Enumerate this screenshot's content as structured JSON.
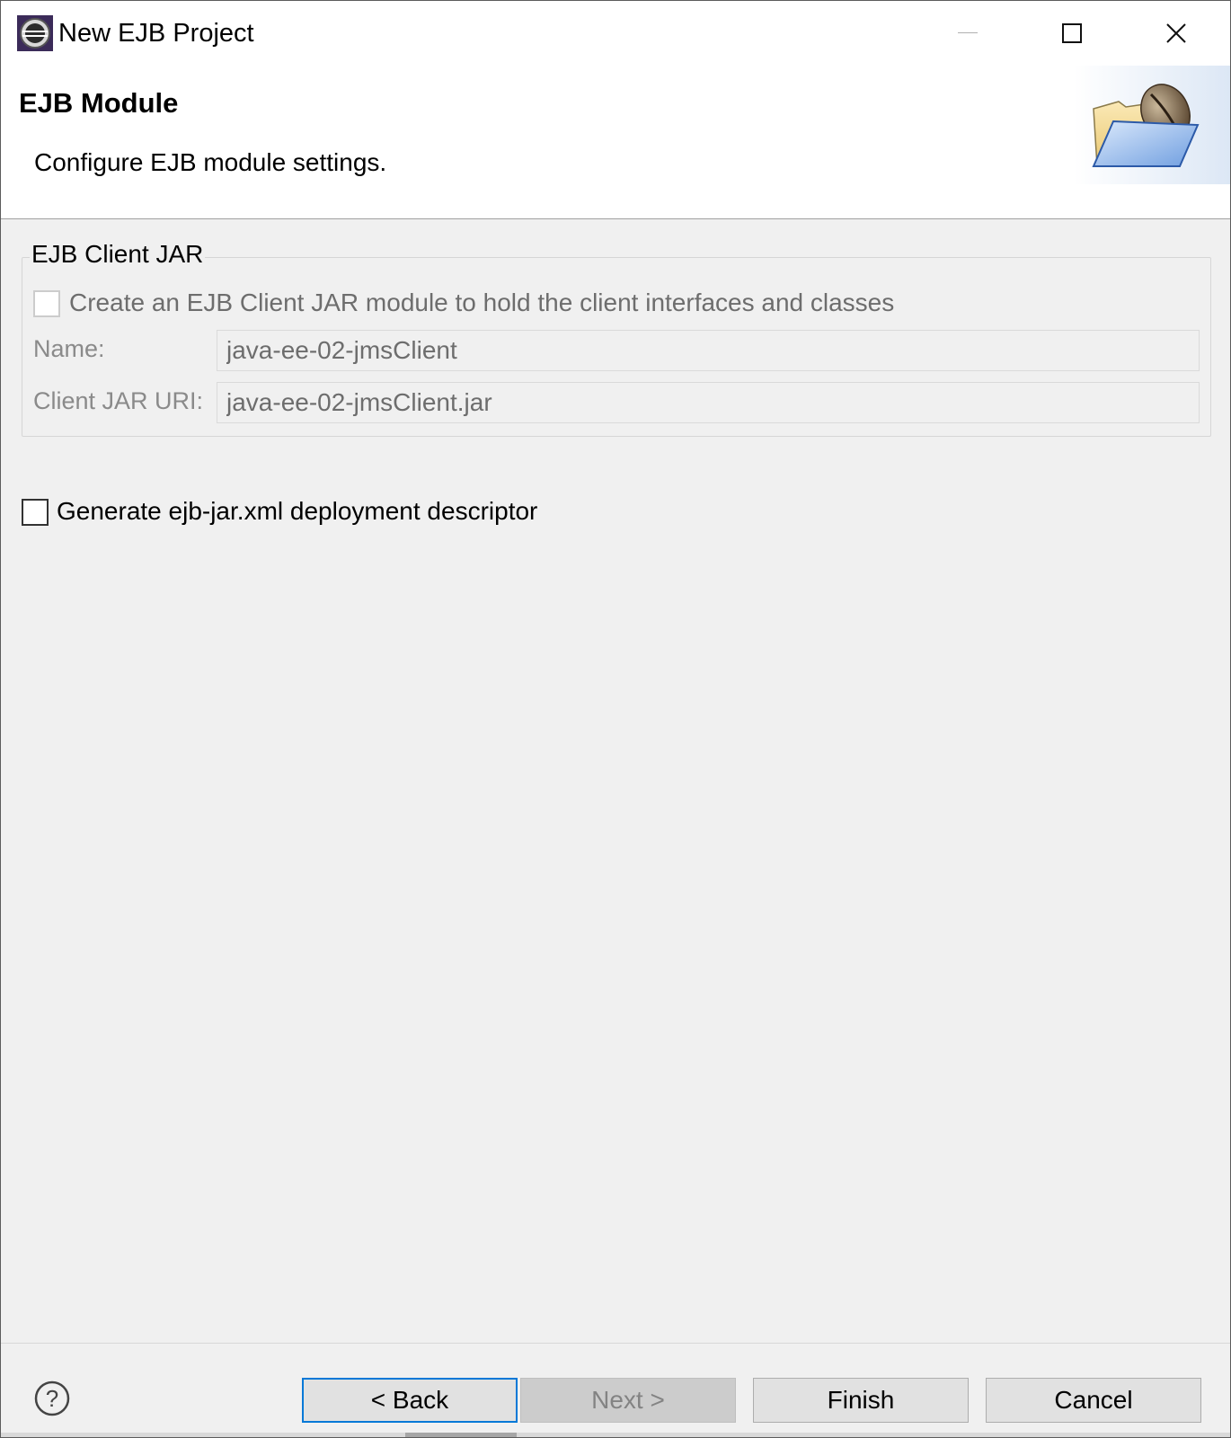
{
  "window": {
    "title": "New EJB Project",
    "app_icon": "eclipse-icon",
    "controls": [
      "minimize-icon",
      "maximize-icon",
      "close-icon"
    ]
  },
  "banner": {
    "title": "EJB Module",
    "description": "Configure EJB module settings.",
    "image": "ejb-folder-wizard-icon"
  },
  "client_jar_group": {
    "legend": "EJB Client JAR",
    "create_checkbox": {
      "label": "Create an EJB Client JAR module to hold the client interfaces and classes",
      "checked": false,
      "enabled": false
    },
    "name_label": "Name:",
    "name_value": "java-ee-02-jmsClient",
    "uri_label": "Client JAR URI:",
    "uri_value": "java-ee-02-jmsClient.jar"
  },
  "generate_descriptor": {
    "label": "Generate ejb-jar.xml deployment descriptor",
    "checked": false
  },
  "footer": {
    "help_icon": "help-icon",
    "back": "< Back",
    "next": "Next >",
    "finish": "Finish",
    "cancel": "Cancel"
  },
  "colors": {
    "dialog_bg": "#f0f0f0",
    "banner_bg": "#ffffff",
    "default_button_border": "#0078d7",
    "disabled_text": "#6d6d6d"
  }
}
